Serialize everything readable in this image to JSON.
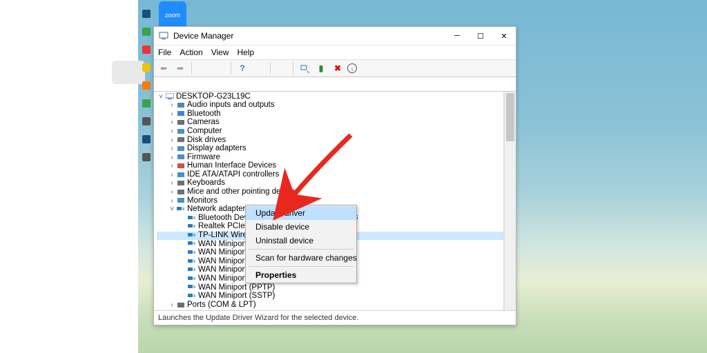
{
  "desktop": {
    "zoom_label": "zoom",
    "taskbar_icons": [
      "app1",
      "app2",
      "app3",
      "app4",
      "app5",
      "app6",
      "app7",
      "app8",
      "app9"
    ],
    "taskbar_colors": [
      "#1a4d7a",
      "#3aa24a",
      "#e33",
      "#f2c200",
      "#ff7a00",
      "#3aa24a",
      "#555",
      "#1a4d7a",
      "#555"
    ]
  },
  "window": {
    "title": "Device Manager",
    "menus": [
      "File",
      "Action",
      "View",
      "Help"
    ],
    "status": "Launches the Update Driver Wizard for the selected device."
  },
  "tree": {
    "root": "DESKTOP-G23L19C",
    "cats": [
      {
        "label": "Audio inputs and outputs",
        "color": "#3a6ea5"
      },
      {
        "label": "Bluetooth",
        "color": "#1e6fd6"
      },
      {
        "label": "Cameras",
        "color": "#555"
      },
      {
        "label": "Computer",
        "color": "#2a7dbb"
      },
      {
        "label": "Disk drives",
        "color": "#555"
      },
      {
        "label": "Display adapters",
        "color": "#2a7dbb"
      },
      {
        "label": "Firmware",
        "color": "#2a7dbb"
      },
      {
        "label": "Human Interface Devices",
        "color": "#c9302c"
      },
      {
        "label": "IDE ATA/ATAPI controllers",
        "color": "#2a7dbb"
      },
      {
        "label": "Keyboards",
        "color": "#555"
      },
      {
        "label": "Mice and other pointing devices",
        "color": "#555"
      },
      {
        "label": "Monitors",
        "color": "#2a7dbb"
      }
    ],
    "net_label": "Network adapters",
    "net_color": "#2a7dbb",
    "adapters": [
      "Bluetooth Device (Personal Area Network) #3",
      "Realtek PCIe GbE Family Controller",
      "TP-LINK Wireles",
      "WAN Miniport (I",
      "WAN Miniport (I",
      "WAN Miniport (I",
      "WAN Miniport (I",
      "WAN Miniport (I",
      "WAN Miniport (PPTP)",
      "WAN Miniport (SSTP)"
    ],
    "adapter_icon_color": "#2a7dbb",
    "selected_index": 2,
    "last": "Ports (COM & LPT)"
  },
  "context_menu": {
    "update": "Update driver",
    "disable": "Disable device",
    "uninstall": "Uninstall device",
    "scan": "Scan for hardware changes",
    "properties": "Properties"
  }
}
